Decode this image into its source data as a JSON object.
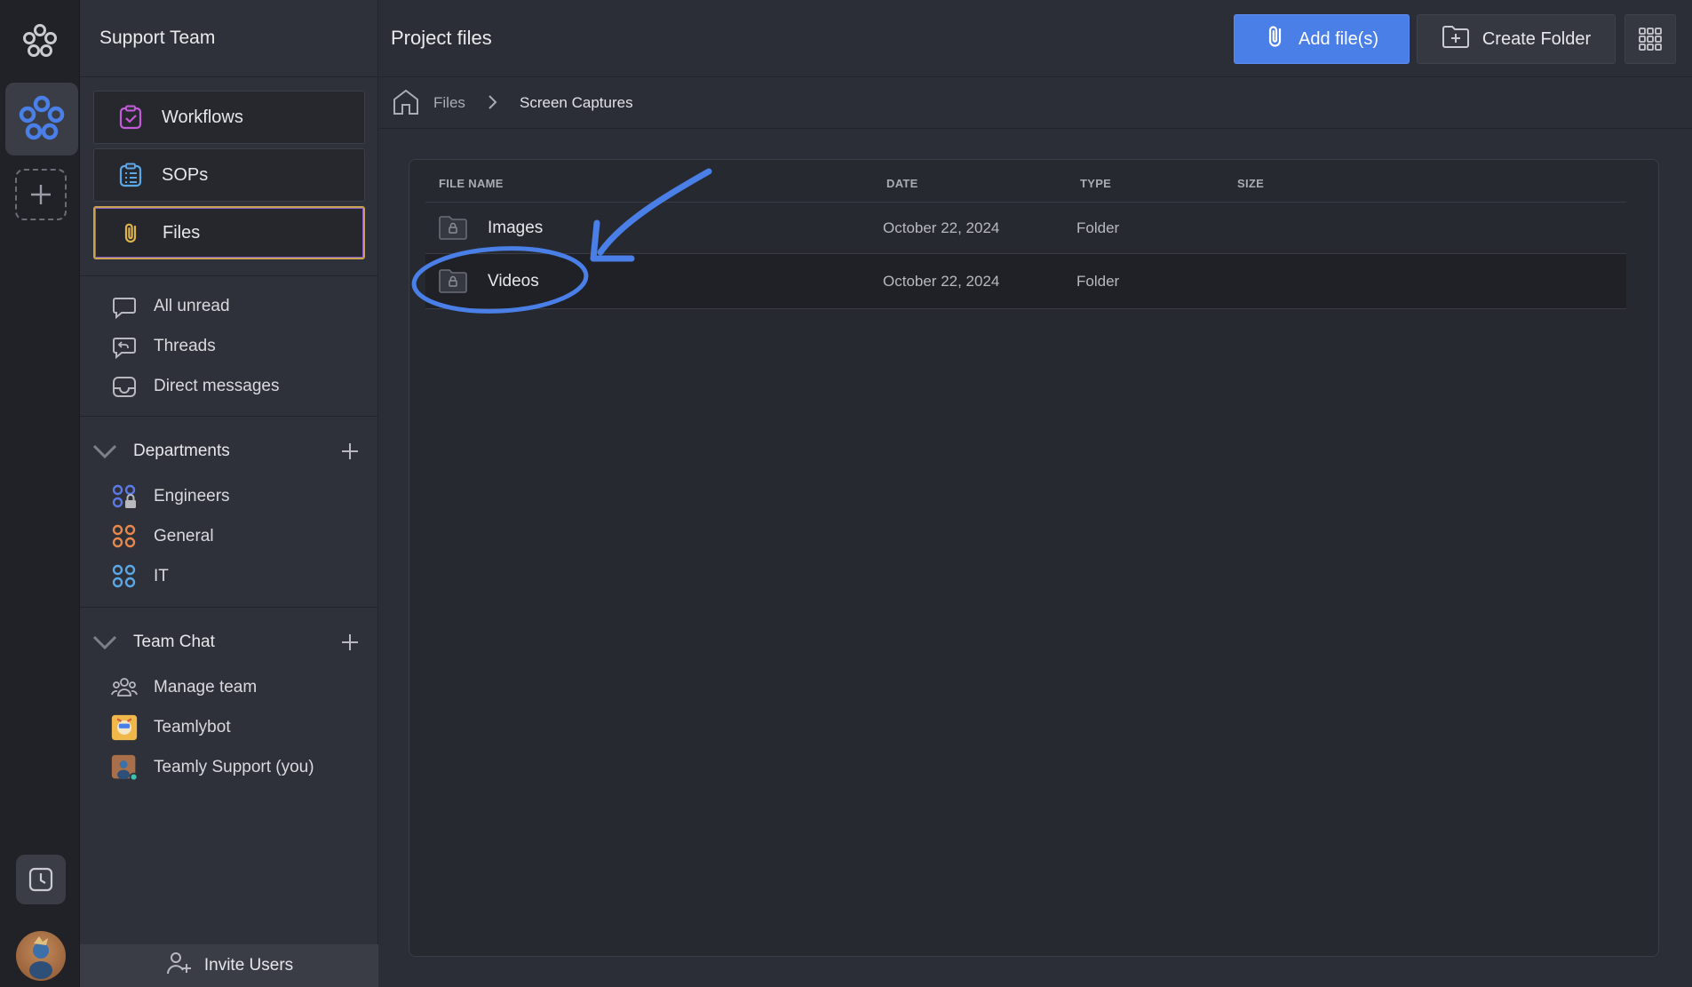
{
  "colors": {
    "accent": "#4a7fe8",
    "annotation": "#4a7fe8",
    "active_border": "#c9a24e",
    "workflows_icon": "#c45bd8",
    "sops_icon": "#5aa8e8",
    "files_icon": "#e0b44a",
    "engineers_icon": "#5b79e8",
    "general_icon": "#e8884a",
    "it_icon": "#5aa8e8"
  },
  "sidebar": {
    "title": "Support Team",
    "nav": [
      {
        "label": "Workflows",
        "icon": "clipboard-check-icon"
      },
      {
        "label": "SOPs",
        "icon": "list-clipboard-icon"
      },
      {
        "label": "Files",
        "icon": "paperclip-icon",
        "active": true
      }
    ],
    "inbox": [
      {
        "label": "All unread",
        "icon": "chat-bubble-icon"
      },
      {
        "label": "Threads",
        "icon": "reply-bubble-icon"
      },
      {
        "label": "Direct messages",
        "icon": "inbox-icon"
      }
    ],
    "departments": {
      "title": "Departments",
      "items": [
        {
          "label": "Engineers",
          "icon": "locked-channel-icon"
        },
        {
          "label": "General",
          "icon": "channel-icon"
        },
        {
          "label": "IT",
          "icon": "channel-icon"
        }
      ]
    },
    "team_chat": {
      "title": "Team Chat",
      "items": [
        {
          "label": "Manage team",
          "icon": "people-icon"
        },
        {
          "label": "Teamlybot",
          "icon": "bot-avatar"
        },
        {
          "label": "Teamly Support (you)",
          "icon": "user-avatar"
        }
      ]
    },
    "invite_label": "Invite Users"
  },
  "header": {
    "title": "Project files",
    "add_files_label": "Add file(s)",
    "create_folder_label": "Create Folder"
  },
  "breadcrumb": {
    "root": "Files",
    "current": "Screen Captures"
  },
  "table": {
    "columns": [
      "FILE NAME",
      "DATE",
      "TYPE",
      "SIZE"
    ],
    "rows": [
      {
        "name": "Images",
        "date": "October 22, 2024",
        "type": "Folder",
        "size": ""
      },
      {
        "name": "Videos",
        "date": "October 22, 2024",
        "type": "Folder",
        "size": ""
      }
    ]
  }
}
